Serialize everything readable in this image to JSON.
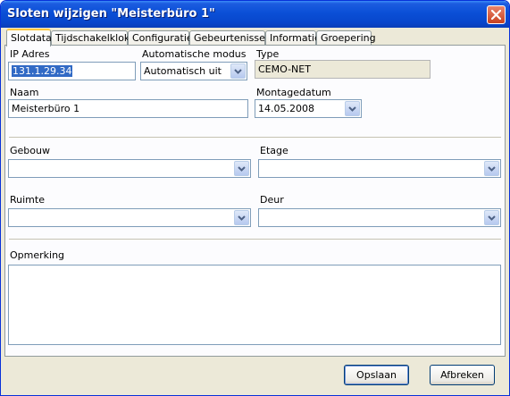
{
  "window": {
    "title": "Sloten wijzigen \"Meisterbüro 1\""
  },
  "tabs": [
    {
      "label": "Slotdata",
      "active": true
    },
    {
      "label": "Tijdschakelklok"
    },
    {
      "label": "Configuratie"
    },
    {
      "label": "Gebeurtenissen"
    },
    {
      "label": "Informatie"
    },
    {
      "label": "Groepering"
    }
  ],
  "form": {
    "ip": {
      "label": "IP Adres",
      "value": "131.1.29.34"
    },
    "auto_mode": {
      "label": "Automatische modus",
      "value": "Automatisch uit"
    },
    "type": {
      "label": "Type",
      "value": "CEMO-NET"
    },
    "name": {
      "label": "Naam",
      "value": "Meisterbüro 1"
    },
    "mount_date": {
      "label": "Montagedatum",
      "value": "14.05.2008"
    },
    "building": {
      "label": "Gebouw",
      "value": ""
    },
    "floor": {
      "label": "Etage",
      "value": ""
    },
    "room": {
      "label": "Ruimte",
      "value": ""
    },
    "door": {
      "label": "Deur",
      "value": ""
    },
    "remark": {
      "label": "Opmerking",
      "value": ""
    }
  },
  "buttons": {
    "save": "Opslaan",
    "cancel": "Afbreken"
  },
  "colors": {
    "titlebar": "#0a4fd6",
    "window_bg": "#ece9d8",
    "selection": "#316ac5",
    "active_tab_accent": "#ffc83c"
  }
}
